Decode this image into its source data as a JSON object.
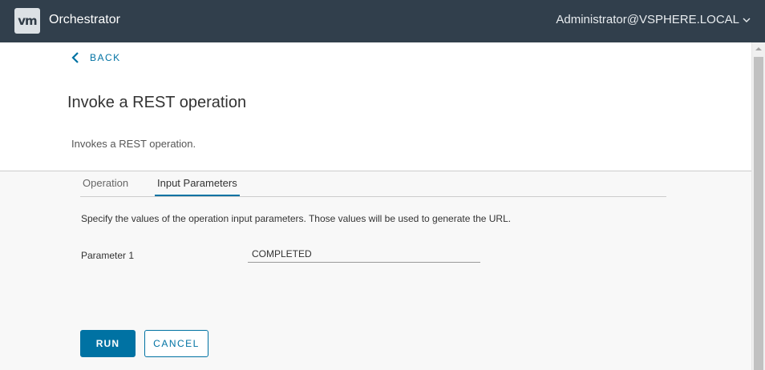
{
  "header": {
    "logo_text": "vm",
    "app_name": "Orchestrator",
    "user": "Administrator@VSPHERE.LOCAL"
  },
  "page": {
    "back_label": "BACK",
    "title": "Invoke a REST operation",
    "description": "Invokes a REST operation."
  },
  "tabs": [
    {
      "label": "Operation",
      "active": false
    },
    {
      "label": "Input Parameters",
      "active": true
    }
  ],
  "form": {
    "instructions": "Specify the values of the operation input parameters. Those values will be used to generate the URL.",
    "param_label": "Parameter 1",
    "param_value": "COMPLETED"
  },
  "buttons": {
    "run_label": "RUN",
    "cancel_label": "CANCEL"
  },
  "colors": {
    "header_bg": "#313f4c",
    "accent": "#0072a3",
    "body_bg": "#f8f8f8"
  },
  "icons": {
    "logo": "vmware-logo-icon",
    "user_menu": "chevron-down-icon",
    "back": "chevron-left-icon",
    "scroll": "scroll-up-arrow-icon"
  }
}
